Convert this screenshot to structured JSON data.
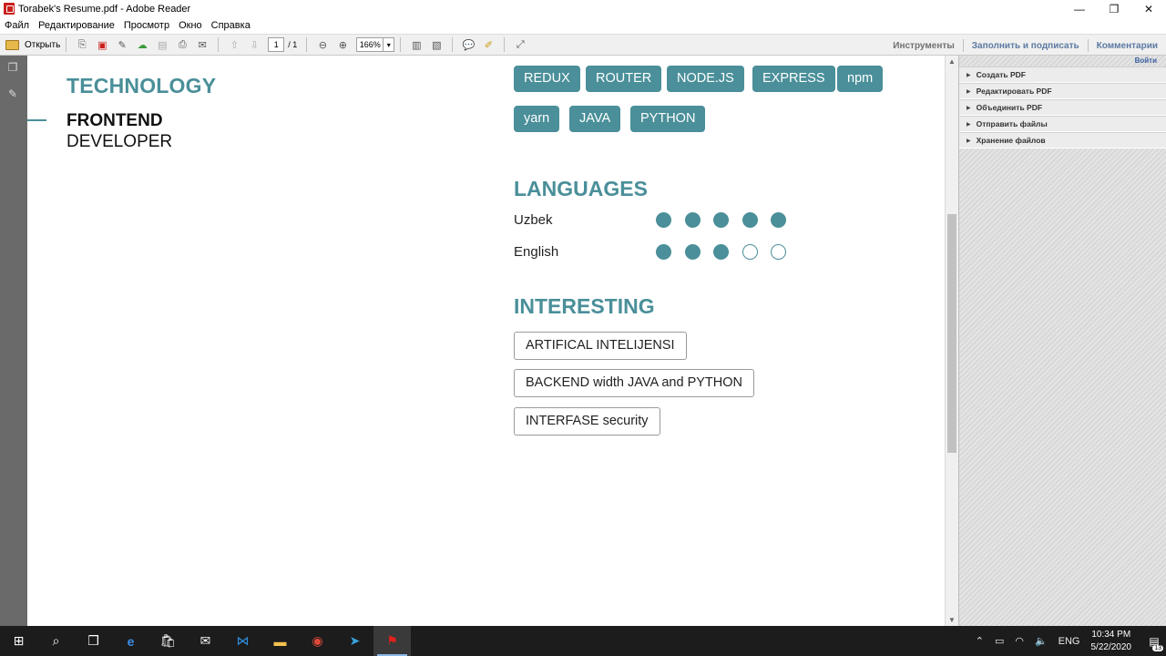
{
  "window": {
    "title": "Torabek's Resume.pdf - Adobe Reader",
    "controls": [
      "—",
      "❐",
      "✕"
    ]
  },
  "menu": [
    "Файл",
    "Редактирование",
    "Просмотр",
    "Окно",
    "Справка"
  ],
  "toolbar": {
    "open_label": "Открыть",
    "page_current": "1",
    "page_total": "/ 1",
    "zoom": "166%",
    "tools_label": "Инструменты",
    "fill_sign_label": "Заполнить и подписать",
    "comments_label": "Комментарии"
  },
  "document": {
    "technology_heading": "TECHNOLOGY",
    "role_line1": "FRONTEND",
    "role_line2": "DEVELOPER",
    "tags": [
      "REDUX",
      "ROUTER",
      "NODE.JS",
      "EXPRESS",
      "npm",
      "yarn",
      "JAVA",
      "PYTHON"
    ],
    "languages_heading": "LANGUAGES",
    "languages": [
      {
        "name": "Uzbek",
        "level": 5,
        "max": 5
      },
      {
        "name": "English",
        "level": 3,
        "max": 5
      }
    ],
    "interesting_heading": "INTERESTING",
    "interests": [
      "ARTIFICAL INTELIJENSI",
      "BACKEND width JAVA and PYTHON",
      "INTERFASE security"
    ]
  },
  "right_pane": {
    "login": "Войти",
    "items": [
      "Создать PDF",
      "Редактировать PDF",
      "Объединить PDF",
      "Отправить файлы",
      "Хранение файлов"
    ]
  },
  "taskbar": {
    "lang": "ENG",
    "time": "10:34 PM",
    "date": "5/22/2020",
    "notifications": "13"
  },
  "colors": {
    "accent": "#4a8f99",
    "link": "#5b7aa2"
  }
}
